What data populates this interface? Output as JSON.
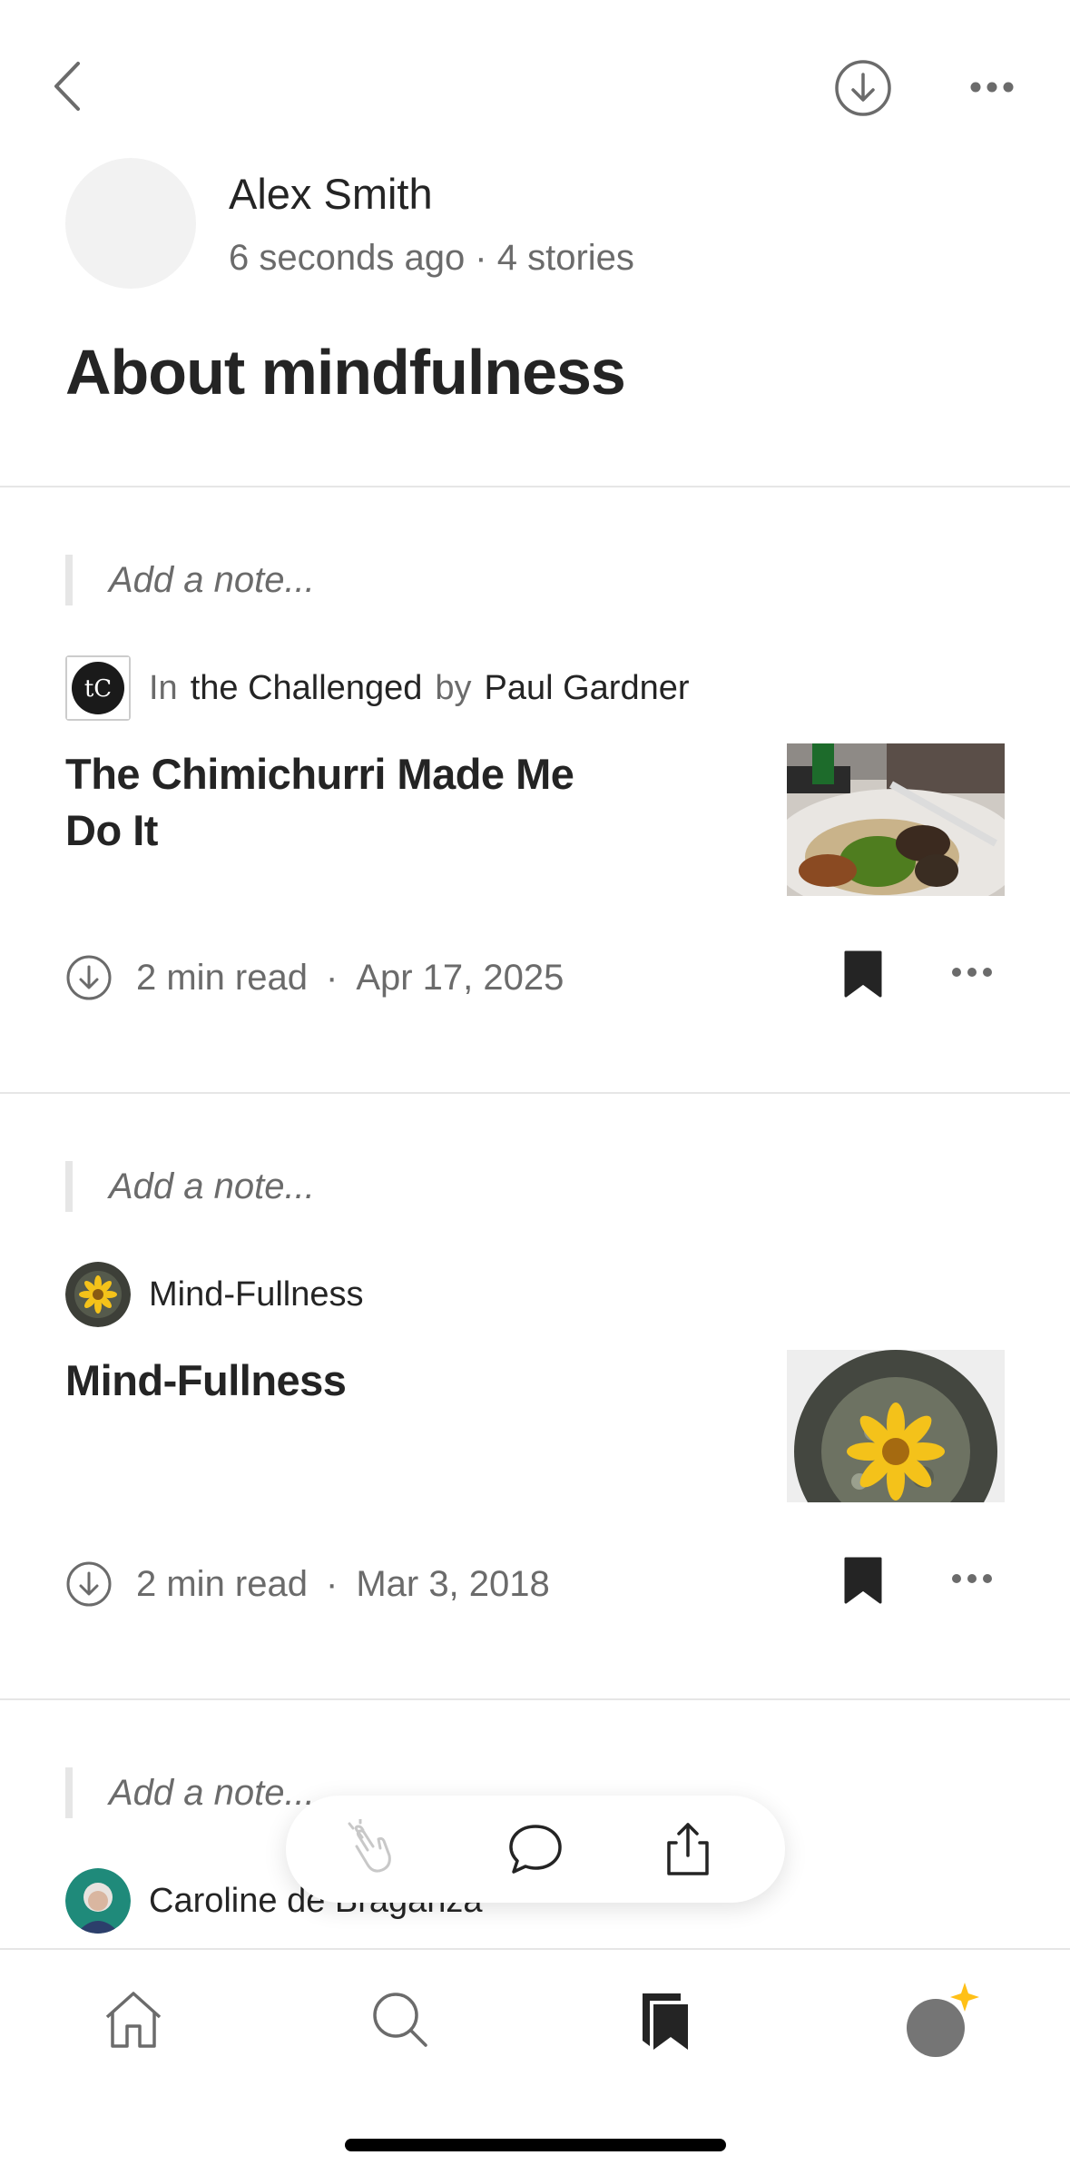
{
  "header": {
    "author_name": "Alex Smith",
    "author_meta": "6 seconds ago · 4 stories",
    "list_title": "About mindfulness"
  },
  "items": [
    {
      "note_placeholder": "Add a note...",
      "pub_prefix": "In",
      "publication": "the Challenged",
      "by_word": "by",
      "author": "Paul Gardner",
      "title": "The Chimichurri Made Me Do It",
      "read_time": "2  min read",
      "date": "Apr 17, 2025"
    },
    {
      "note_placeholder": "Add a note...",
      "publication": "Mind-Fullness",
      "title": "Mind-Fullness",
      "read_time": "2  min read",
      "date": "Mar 3, 2018"
    },
    {
      "note_placeholder": "Add a note...",
      "author": "Caroline de Braganza"
    }
  ],
  "icons": {
    "back": "chevron-left-icon",
    "download": "download-icon",
    "more": "more-icon",
    "bookmark": "bookmark-filled-icon",
    "clap": "clap-icon",
    "comment": "comment-icon",
    "share": "share-icon",
    "home": "home-icon",
    "search": "search-icon",
    "library": "library-icon",
    "profile": "profile-avatar"
  },
  "colors": {
    "text": "#242424",
    "muted": "#6b6b6b",
    "accent_star": "#ffc017"
  }
}
